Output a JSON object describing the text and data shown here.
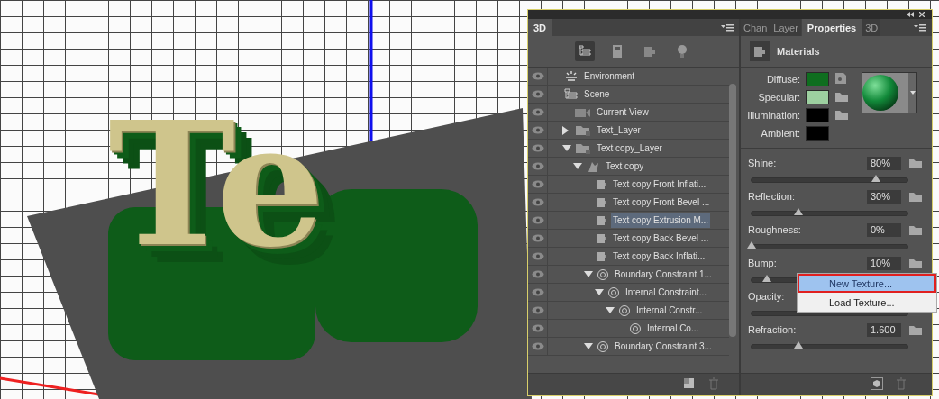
{
  "viewport": {
    "text": "Te"
  },
  "panel_3d": {
    "tab": "3D",
    "tree": [
      {
        "label": "Environment",
        "kind": "environment",
        "selected": false
      },
      {
        "label": "Scene",
        "kind": "scene",
        "selected": false,
        "children": [
          {
            "label": "Current View",
            "kind": "camera",
            "selected": false
          },
          {
            "label": "Text_Layer",
            "kind": "folder",
            "expanded": false,
            "selected": false
          },
          {
            "label": "Text copy_Layer",
            "kind": "folder",
            "expanded": true,
            "selected": false,
            "children": [
              {
                "label": "Text copy",
                "kind": "mesh",
                "expanded": true,
                "selected": false,
                "children": [
                  {
                    "label": "Text copy Front Inflati...",
                    "kind": "material",
                    "selected": false
                  },
                  {
                    "label": "Text copy Front Bevel ...",
                    "kind": "material",
                    "selected": false
                  },
                  {
                    "label": "Text copy Extrusion M...",
                    "kind": "material",
                    "selected": true
                  },
                  {
                    "label": "Text copy Back Bevel ...",
                    "kind": "material",
                    "selected": false
                  },
                  {
                    "label": "Text copy Back Inflati...",
                    "kind": "material",
                    "selected": false
                  },
                  {
                    "label": "Boundary Constraint 1...",
                    "kind": "constraint",
                    "expanded": true,
                    "selected": false,
                    "children": [
                      {
                        "label": "Internal Constraint...",
                        "kind": "constraint",
                        "expanded": true,
                        "selected": false,
                        "children": [
                          {
                            "label": "Internal Constr...",
                            "kind": "constraint",
                            "expanded": true,
                            "selected": false,
                            "children": [
                              {
                                "label": "Internal Co...",
                                "kind": "constraint",
                                "selected": false
                              }
                            ]
                          }
                        ]
                      }
                    ]
                  },
                  {
                    "label": "Boundary Constraint 3...",
                    "kind": "constraint",
                    "expanded": true,
                    "selected": false
                  }
                ]
              }
            ]
          }
        ]
      }
    ]
  },
  "properties_panel": {
    "tabs": [
      {
        "label": "Chan",
        "selected": false
      },
      {
        "label": "Layer",
        "selected": false
      },
      {
        "label": "Properties",
        "selected": true
      },
      {
        "label": "3D",
        "selected": false
      }
    ],
    "header": "Materials",
    "colors": [
      {
        "label": "Diffuse:",
        "color": "#0f6e1f",
        "kind": "image"
      },
      {
        "label": "Specular:",
        "color": "#9dd0a0",
        "kind": "folder"
      },
      {
        "label": "Illumination:",
        "color": "#000000",
        "kind": "folder"
      },
      {
        "label": "Ambient:",
        "color": "#000000",
        "kind": "plain"
      }
    ],
    "sliders": [
      {
        "label": "Shine:",
        "value": "80%",
        "level": 0.8
      },
      {
        "label": "Reflection:",
        "value": "30%",
        "level": 0.3
      },
      {
        "label": "Roughness:",
        "value": "0%",
        "level": 0
      },
      {
        "label": "Bump:",
        "value": "10%",
        "level": 0.1
      },
      {
        "label": "Opacity:"
      },
      {
        "label": "Refraction:",
        "value": "1.600",
        "level": 0.3
      }
    ],
    "menu": [
      {
        "label": "New Texture...",
        "selected": true
      },
      {
        "label": "Load Texture...",
        "selected": false
      }
    ]
  }
}
